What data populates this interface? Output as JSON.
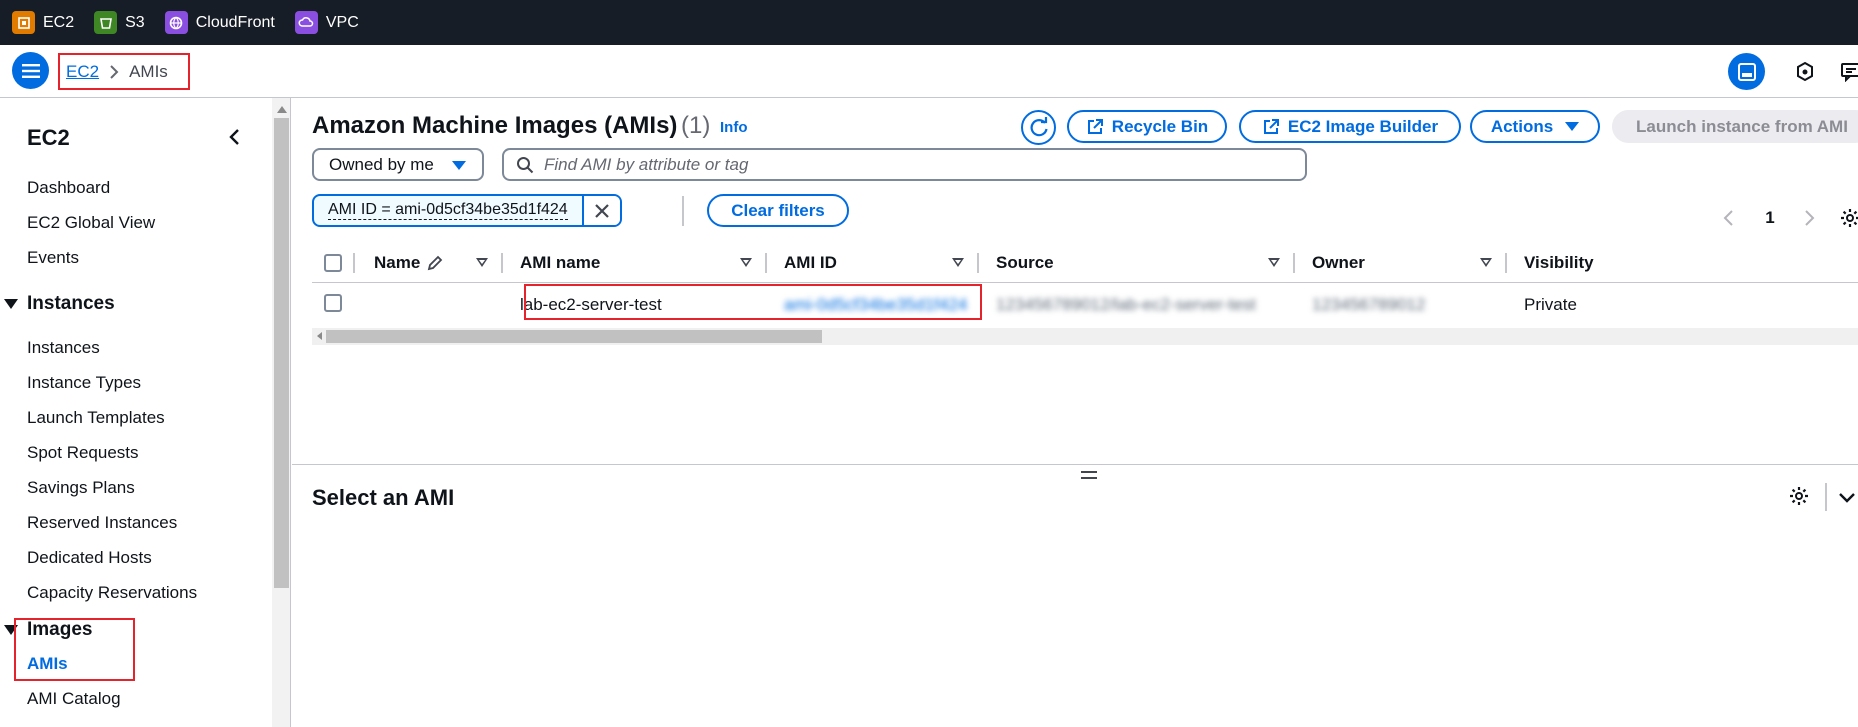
{
  "service_bar": {
    "items": [
      {
        "label": "EC2",
        "icon": "ec2-icon",
        "color": "#e07b00"
      },
      {
        "label": "S3",
        "icon": "s3-icon",
        "color": "#3f8624"
      },
      {
        "label": "CloudFront",
        "icon": "cloudfront-icon",
        "color": "#8a4fe0"
      },
      {
        "label": "VPC",
        "icon": "vpc-icon",
        "color": "#8a4fe0"
      }
    ]
  },
  "breadcrumb": {
    "parent": "EC2",
    "current": "AMIs"
  },
  "sidenav": {
    "title": "EC2",
    "links": [
      "Dashboard",
      "EC2 Global View",
      "Events"
    ],
    "instances_section": "Instances",
    "instances_links": [
      "Instances",
      "Instance Types",
      "Launch Templates",
      "Spot Requests",
      "Savings Plans",
      "Reserved Instances",
      "Dedicated Hosts",
      "Capacity Reservations"
    ],
    "images_section": "Images",
    "images_links": [
      "AMIs",
      "AMI Catalog"
    ]
  },
  "main": {
    "title": "Amazon Machine Images (AMIs)",
    "count": "(1)",
    "info": "Info",
    "buttons": {
      "recycle_bin": "Recycle Bin",
      "image_builder": "EC2 Image Builder",
      "actions": "Actions",
      "launch": "Launch instance from AMI",
      "clear_filters": "Clear filters"
    },
    "owner_filter": "Owned by me",
    "search_placeholder": "Find AMI by attribute or tag",
    "filter_token": "AMI ID = ami-0d5cf34be35d1f424",
    "page": "1"
  },
  "table": {
    "columns": [
      "Name",
      "AMI name",
      "AMI ID",
      "Source",
      "Owner",
      "Visibility"
    ],
    "rows": [
      {
        "name": "",
        "ami_name": "lab-ec2-server-test",
        "ami_id": "ami-0d5cf34be35d1f424",
        "source": "123456789012/lab-ec2-server-test",
        "owner": "123456789012",
        "visibility": "Private"
      }
    ]
  },
  "split_panel": {
    "title": "Select an AMI"
  },
  "colors": {
    "accent": "#006ce0",
    "highlight": "#e5232d",
    "topbar": "#161d26"
  }
}
